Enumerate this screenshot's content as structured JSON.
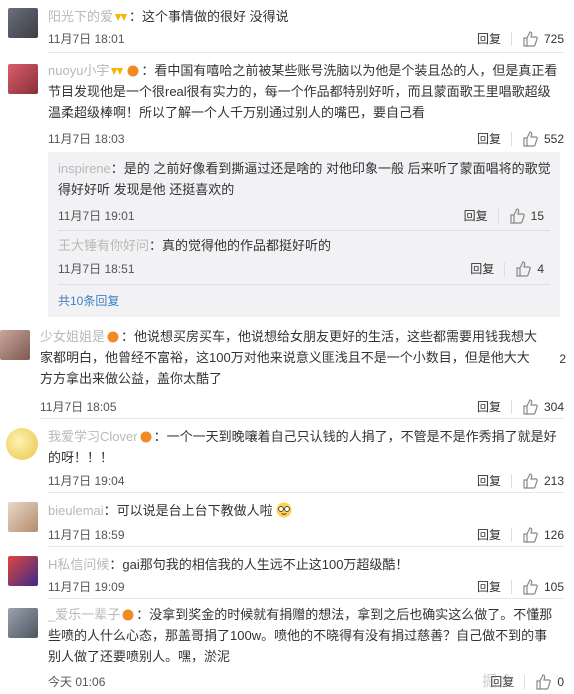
{
  "comments": [
    {
      "user": "阳光下的爱",
      "text": "：这个事情做的很好 没得说",
      "time": "11月7日 18:01",
      "reply": "回复",
      "likes": "725"
    },
    {
      "user": "nuoyu小宇",
      "text": "：看中国有嘻哈之前被某些账号洗脑以为他是个装且怂的人，但是真正看节目发现他是一个很real很有实力的，每一个作品都特别好听，而且蒙面歌王里唱歌超级温柔超级棒啊！所以了解一个人千万别通过别人的嘴巴，要自己看",
      "time": "11月7日 18:03",
      "reply": "回复",
      "likes": "552"
    },
    {
      "user": "少女姐姐是",
      "text": "：他说想买房买车，他说想给女朋友更好的生活，这些都需要用钱我想大家都明白，他曾经不富裕，这100万对他来说意义匪浅且不是一个小数目，但是他大大方方拿出来做公益，盖你太酷了",
      "time": "11月7日 18:05",
      "reply": "回复",
      "likes": "304",
      "side": "2"
    },
    {
      "user": "我爱学习Clover",
      "text": "：一个一天到晚嚷着自己只认钱的人捐了，不管是不是作秀捐了就是好的呀！！！",
      "time": "11月7日 19:04",
      "reply": "回复",
      "likes": "213"
    },
    {
      "user": "bieulemai",
      "text": "：可以说是台上台下教做人啦",
      "time": "11月7日 18:59",
      "reply": "回复",
      "likes": "126"
    },
    {
      "user": "H私信问候",
      "text": "：gai那句我的相信我的人生远不止这100万超级酷！",
      "time": "11月7日 19:09",
      "reply": "回复",
      "likes": "105"
    },
    {
      "user": "_爱乐一辈子",
      "text": "：没拿到奖金的时候就有捐赠的想法，拿到之后也确实这么做了。不懂那些喷的人什么心态，那盖哥捐了100w。喷他的不晓得有没有捐过慈善？自己做不到的事别人做了还要喷别人。嘿，淤泥",
      "time": "今天 01:06",
      "reply": "回复",
      "likes": "0"
    }
  ],
  "subreplies": [
    {
      "user": "inspirene",
      "text": "：是的 之前好像看到撕逼过还是啥的 对他印象一般 后来听了蒙面唱将的歌觉得好好听 发现是他 还挺喜欢的",
      "time": "11月7日 19:01",
      "reply": "回复",
      "likes": "15"
    },
    {
      "user": "王大锤有你好问",
      "text": "：真的觉得他的作品都挺好听的",
      "time": "11月7日 18:51",
      "reply": "回复",
      "likes": "4"
    }
  ],
  "more_replies": "共10条回复",
  "watermark": "掘金"
}
